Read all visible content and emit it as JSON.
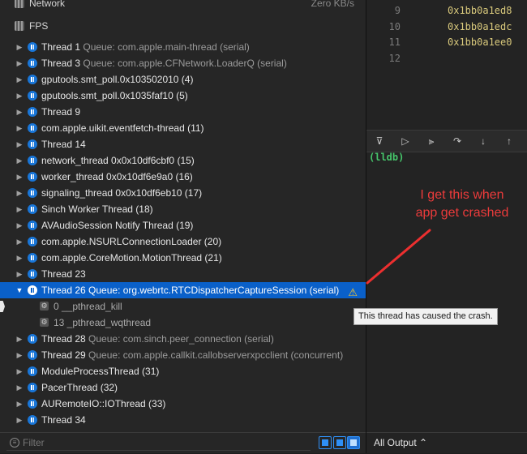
{
  "gauges": {
    "network": {
      "label": "Network",
      "value": "Zero KB/s",
      "icon": "network-gauge-icon"
    },
    "fps": {
      "label": "FPS",
      "icon": "fps-gauge-icon"
    }
  },
  "threads": [
    {
      "name": "Thread 1",
      "queue": "Queue: com.apple.main-thread (serial)"
    },
    {
      "name": "Thread 3",
      "queue": "Queue: com.apple.CFNetwork.LoaderQ (serial)"
    },
    {
      "name": "gputools.smt_poll.0x103502010 (4)",
      "queue": ""
    },
    {
      "name": "gputools.smt_poll.0x1035faf10 (5)",
      "queue": ""
    },
    {
      "name": "Thread 9",
      "queue": ""
    },
    {
      "name": "com.apple.uikit.eventfetch-thread (11)",
      "queue": ""
    },
    {
      "name": "Thread 14",
      "queue": ""
    },
    {
      "name": "network_thread 0x0x10df6cbf0 (15)",
      "queue": ""
    },
    {
      "name": "worker_thread 0x0x10df6e9a0 (16)",
      "queue": ""
    },
    {
      "name": "signaling_thread 0x0x10df6eb10 (17)",
      "queue": ""
    },
    {
      "name": "Sinch Worker Thread (18)",
      "queue": ""
    },
    {
      "name": "AVAudioSession Notify Thread (19)",
      "queue": ""
    },
    {
      "name": "com.apple.NSURLConnectionLoader (20)",
      "queue": ""
    },
    {
      "name": "com.apple.CoreMotion.MotionThread (21)",
      "queue": ""
    },
    {
      "name": "Thread 23",
      "queue": ""
    }
  ],
  "crashed_thread": {
    "name": "Thread 26",
    "queue": "Queue: org.webrtc.RTCDispatcherCaptureSession (serial)"
  },
  "frames": [
    "0 __pthread_kill",
    "13 _pthread_wqthread"
  ],
  "threads_after": [
    {
      "name": "Thread 28",
      "queue": "Queue: com.sinch.peer_connection (serial)"
    },
    {
      "name": "Thread 29",
      "queue": "Queue: com.apple.callkit.callobserverxpcclient (concurrent)"
    },
    {
      "name": "ModuleProcessThread (31)",
      "queue": ""
    },
    {
      "name": "PacerThread (32)",
      "queue": ""
    },
    {
      "name": "AURemoteIO::IOThread (33)",
      "queue": ""
    },
    {
      "name": "Thread 34",
      "queue": ""
    }
  ],
  "tooltip": "This thread has caused the crash.",
  "filter": {
    "placeholder": "Filter"
  },
  "code_lines": [
    {
      "num": "9",
      "code": "0x1bb0a1ed8"
    },
    {
      "num": "10",
      "code": "0x1bb0a1edc"
    },
    {
      "num": "11",
      "code": "0x1bb0a1ee0"
    },
    {
      "num": "12",
      "code": ""
    }
  ],
  "console": {
    "prompt": "(lldb)"
  },
  "annotation": {
    "line1": "I get this when",
    "line2": "app get crashed",
    "color": "#ec3b3b"
  },
  "output_selector": {
    "label": "All Output",
    "chevron": "⌃"
  },
  "colors": {
    "selection": "#0a60c9",
    "thread_icon": "#1976d8",
    "warning": "#f4c430",
    "lldb": "#46c56b"
  }
}
